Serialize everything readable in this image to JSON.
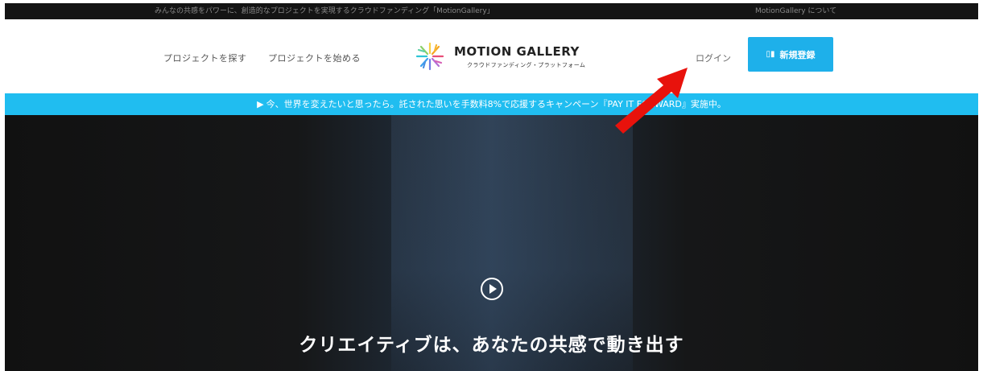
{
  "topbar": {
    "tagline": "みんなの共感をパワーに、創造的なプロジェクトを実現するクラウドファンディング「MotionGallery」",
    "about": "MotionGallery について"
  },
  "header": {
    "nav_find": "プロジェクトを探す",
    "nav_start": "プロジェクトを始める",
    "logo_title": "MOTION GALLERY",
    "logo_subtitle": "クラウドファンディング・プラットフォーム",
    "login": "ログイン",
    "signup": "新規登録"
  },
  "banner": {
    "text": "今、世界を変えたいと思ったら。託された思いを手数料8%で応援するキャンペーン『PAY IT FORWARD』実施中。"
  },
  "hero": {
    "title": "クリエイティブは、あなたの共感で動き出す"
  },
  "colors": {
    "accent": "#1eb0ea",
    "banner": "#20bdf0",
    "annotation_arrow": "#e8120c"
  },
  "icons": [
    "logo-burst-icon",
    "book-icon",
    "flag-icon",
    "play-icon",
    "annotation-arrow"
  ]
}
